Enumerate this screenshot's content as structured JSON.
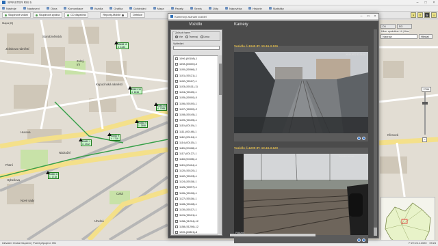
{
  "app": {
    "title": "SPINSTER RIS 5",
    "window_controls": [
      "–",
      "□",
      "×"
    ]
  },
  "menu": [
    {
      "label": "Nástroje",
      "icon": "tools-icon"
    },
    {
      "label": "Nastavení",
      "icon": "settings-icon"
    },
    {
      "label": "Okna",
      "icon": "windows-icon"
    },
    {
      "label": "Komunikace",
      "icon": "chat-icon"
    },
    {
      "label": "Vozidla",
      "icon": "bus-icon"
    },
    {
      "label": "Grafika",
      "icon": "chart-icon"
    },
    {
      "label": "Dohledání",
      "icon": "search-icon"
    },
    {
      "label": "Mapa",
      "icon": "map-icon"
    },
    {
      "label": "Panely",
      "icon": "panel-icon"
    },
    {
      "label": "Servis",
      "icon": "wrench-icon"
    },
    {
      "label": "Účty",
      "icon": "account-icon"
    },
    {
      "label": "Nápověda",
      "icon": "help-icon"
    },
    {
      "label": "Historie",
      "icon": "history-icon"
    },
    {
      "label": "Statistiky",
      "icon": "stats-icon"
    }
  ],
  "toolbar": {
    "buttons": [
      "Skupinové volání",
      "Skupinová zpráva",
      "CD dispečink",
      "Reporty-Mobile",
      "Detekce"
    ],
    "right_buttons": [
      "?",
      "T",
      "D",
      "!"
    ]
  },
  "map": {
    "title": "Mapa [B]",
    "labels": [
      "Jiráskovo náměstí",
      "Starobrněnská",
      "Zelný trh",
      "Kapucínská náměstí",
      "Husova",
      "Nádražní",
      "Nové sady",
      "Úzká",
      "Křenová",
      "Uhelná",
      "Plotní",
      "Hybešova"
    ],
    "vehicles": [
      {
        "text": "00458 12\n4  1134"
      },
      {
        "text": "00461 18\n4  1616"
      },
      {
        "text": "00463 5\n4  7095"
      },
      {
        "text": "00448 9\n1  2558"
      },
      {
        "text": "00462 1\n4  1722"
      },
      {
        "text": "00460 9\n4  1716"
      },
      {
        "text": "00450 8\n1  1718"
      }
    ],
    "right_panel": {
      "tabs": [
        "D1",
        "D3"
      ],
      "zone_label": "Ulice: zpožděné 14 | Mus",
      "search_placeholder": "Nádraží",
      "search_button": "Hledat",
      "zoom_value": "2764"
    }
  },
  "modal": {
    "title": "Kamerový záznam vozidel",
    "left_heading": "Vozidlo",
    "right_heading": "Kamery",
    "filter_legend": "Způsob řazení",
    "radios": [
      {
        "label": "Vše",
        "checked": true
      },
      {
        "label": "Tramvaj",
        "checked": false
      },
      {
        "label": "Linka",
        "checked": false
      }
    ],
    "search_label": "Vyhledání",
    "vehicles": [
      "1096-(00108)-1",
      "1098-(00000)-0",
      "1100-(00066)-2",
      "1101-(00121)-1",
      "1102-(00117)-1",
      "1103-(00111)-11",
      "1104-(00115)-1",
      "1105-(00000)-0",
      "1106-(00100)-1",
      "1107-(00000)-2",
      "1108-(00145)-1",
      "1109-(00105)-1",
      "1110-(00119)-1",
      "1111-(00148)-1",
      "1112-(00124)-1",
      "1114-(00115)-1",
      "1115-(00418)-4",
      "1117-(00127)-1",
      "1118-(00406)-4",
      "1119-(00414)-4",
      "1120-(00120)-1",
      "1122-(00133)-1",
      "1124-(00118)-1",
      "1125-(00097)-1",
      "1126-(00126)-1",
      "1127-(00116)-1",
      "1128-(00128)-1",
      "1130-(00117)-1",
      "1131-(00131)-1",
      "1158-(01204)-12",
      "1158-(01206)-12",
      "1205-(00821)-8",
      "1206-(01218)-12",
      "1210-(00113)-1",
      "1211-(00123)-1",
      "1212-(00126)-1"
    ],
    "cameras": [
      {
        "label": "Vozidlo č.1040  IP: 10.16.3.126",
        "timestamp": "26.04.2022 12:15:16",
        "footer": ""
      },
      {
        "label": "Vozidlo č.1209  IP: 10.16.3.120",
        "timestamp": "Nejbližší snímek",
        "footer": "Přiblížení"
      }
    ]
  },
  "status": {
    "left": "Uživatel: Ondra Dispečer | Počet připojení: 391",
    "right": [
      "F:2H 24.1.2020",
      "09:24"
    ]
  }
}
